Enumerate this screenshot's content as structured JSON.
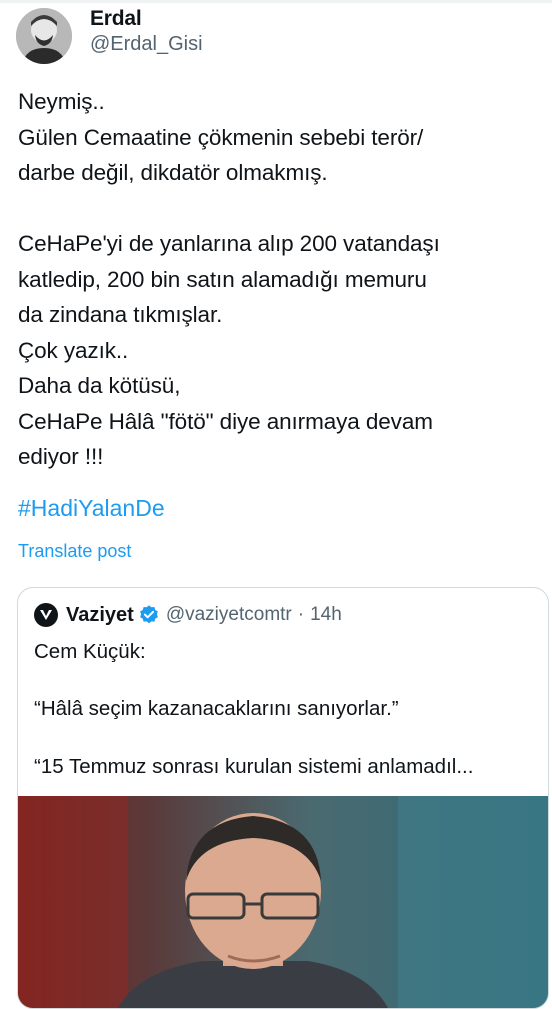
{
  "tweet": {
    "author_name": "Erdal",
    "author_handle": "@Erdal_Gisi",
    "text": "Neymiş..\nGülen Cemaatine çökmenin sebebi terör/\ndarbe değil, dikdatör olmakmış.\n\nCeHaPe'yi de yanlarına alıp 200 vatandaşı\nkatledip, 200 bin satın alamadığı memuru\nda zindana tıkmışlar.\nÇok yazık..\nDaha da kötüsü,\nCeHaPe Hâlâ \"fötö\" diye anırmaya devam\nediyor !!!",
    "hashtag": "#HadiYalanDe",
    "translate_label": "Translate post"
  },
  "quote": {
    "author_name": "Vaziyet",
    "author_handle": "@vaziyetcomtr",
    "separator": "·",
    "time": "14h",
    "line1": "Cem Küçük:",
    "line2": "“Hâlâ seçim kazanacaklarını sanıyorlar.”",
    "line3": "“15 Temmuz sonrası kurulan sistemi anlamadıl..."
  },
  "colors": {
    "link_blue": "#1d9bf0",
    "secondary_text": "#536471",
    "border": "#cfd9de"
  },
  "icons": {
    "avatar": "profile-photo",
    "quote_logo": "vaziyet-v-logo",
    "verified": "verified-badge-icon"
  }
}
